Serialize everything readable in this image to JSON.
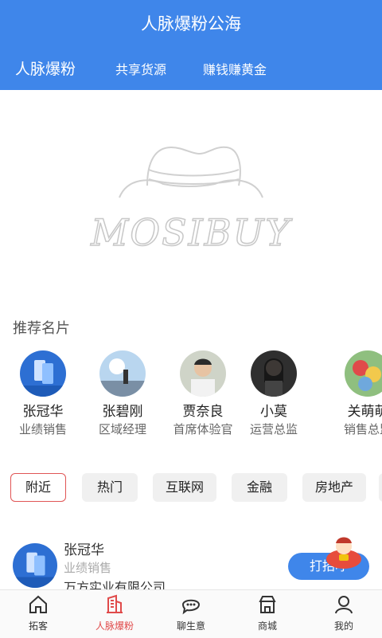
{
  "header": {
    "title": "人脉爆粉公海",
    "tabs": [
      {
        "label": "人脉爆粉"
      },
      {
        "label": "共享货源"
      },
      {
        "label": "赚钱赚黄金"
      }
    ]
  },
  "banner": {
    "logo_text": "MOSIBUY"
  },
  "recommended": {
    "title": "推荐名片",
    "cards": [
      {
        "name": "张冠华",
        "role": "业绩销售",
        "avatar_icon": "app-promo-avatar"
      },
      {
        "name": "张碧刚",
        "role": "区域经理",
        "avatar_icon": "sky-photo-avatar"
      },
      {
        "name": "贾奈良",
        "role": "首席体验官",
        "avatar_icon": "man-photo-avatar"
      },
      {
        "name": "小莫",
        "role": "运营总监",
        "avatar_icon": "woman-photo-avatar"
      },
      {
        "name": "关萌萌",
        "role": "销售总监",
        "avatar_icon": "colorful-photo-avatar"
      }
    ]
  },
  "filters": [
    {
      "label": "附近",
      "active": true
    },
    {
      "label": "热门"
    },
    {
      "label": "互联网"
    },
    {
      "label": "金融"
    },
    {
      "label": "房地产"
    }
  ],
  "list": [
    {
      "name": "张冠华",
      "role": "业绩销售",
      "company": "万方实业有限公司",
      "button": "打招呼"
    }
  ],
  "bottom_nav": [
    {
      "label": "拓客",
      "icon": "home-icon"
    },
    {
      "label": "人脉爆粉",
      "icon": "building-icon",
      "active": true
    },
    {
      "label": "聊生意",
      "icon": "chat-icon"
    },
    {
      "label": "商城",
      "icon": "shop-icon"
    },
    {
      "label": "我的",
      "icon": "user-icon"
    }
  ],
  "colors": {
    "primary": "#3f86ea",
    "accent": "#e04a4a"
  }
}
